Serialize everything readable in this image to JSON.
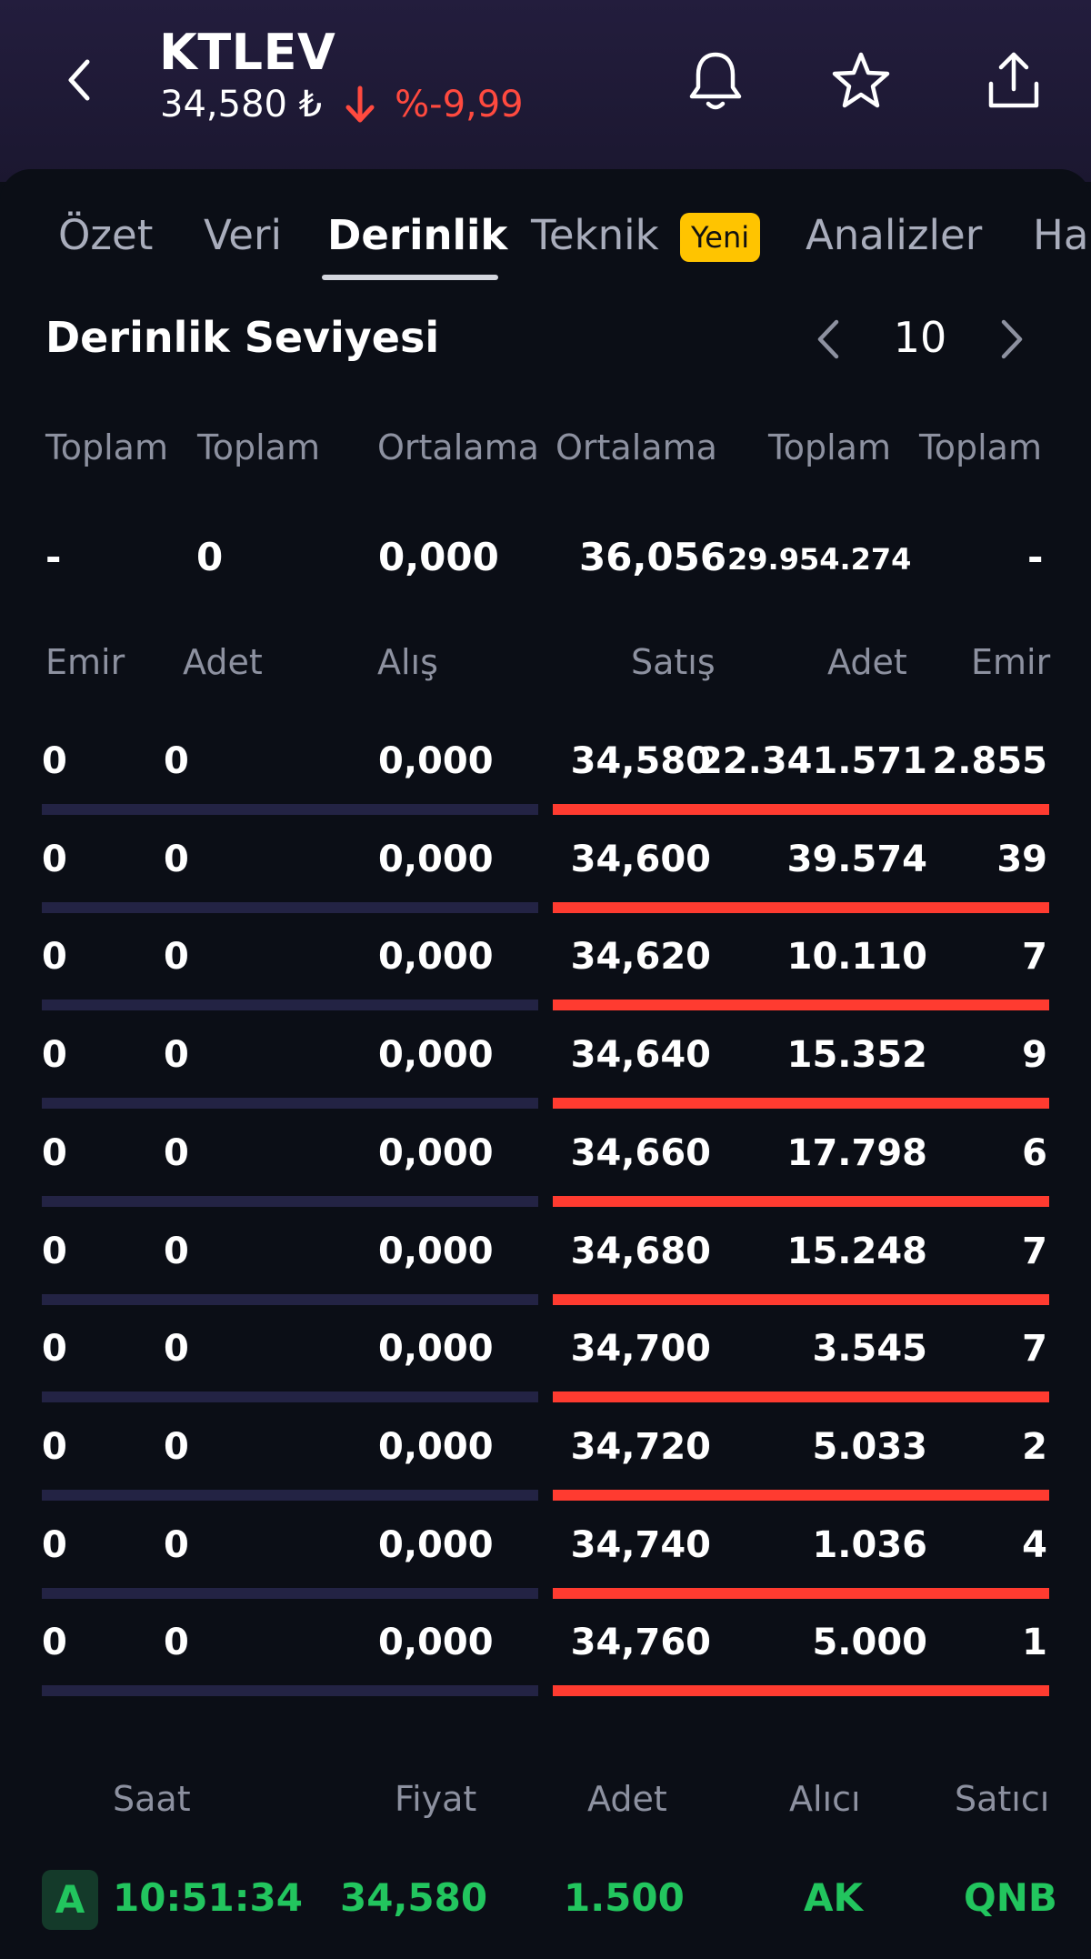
{
  "header": {
    "symbol": "KTLEV",
    "price": "34,580 ₺",
    "change": "%-9,99",
    "change_color": "#ff4a3f",
    "icons": [
      "chevron-left-icon",
      "bell-icon",
      "star-icon",
      "share-icon"
    ]
  },
  "tabs": [
    {
      "label": "Özet"
    },
    {
      "label": "Veri"
    },
    {
      "label": "Derinlik"
    },
    {
      "label": "Teknik"
    },
    {
      "label": "Analizler"
    },
    {
      "label": "Ha"
    }
  ],
  "tab_badge": "Yeni",
  "tab_badge_color": "#ffc400",
  "depth": {
    "title": "Derinlik Seviyesi",
    "level": "10",
    "summary_headers": [
      "Toplam",
      "Toplam",
      "Ortalama",
      "Ortalama",
      "Toplam",
      "Toplam"
    ],
    "summary_values": [
      "-",
      "0",
      "0,000",
      "36,056",
      "29.954.274",
      "-"
    ],
    "column_headers": [
      "Emir",
      "Adet",
      "Alış",
      "Satış",
      "Adet",
      "Emir"
    ],
    "rows": [
      {
        "buy_orders": "0",
        "buy_qty": "0",
        "bid": "0,000",
        "ask": "34,580",
        "sell_qty": "22.341.571",
        "sell_orders": "2.855"
      },
      {
        "buy_orders": "0",
        "buy_qty": "0",
        "bid": "0,000",
        "ask": "34,600",
        "sell_qty": "39.574",
        "sell_orders": "39"
      },
      {
        "buy_orders": "0",
        "buy_qty": "0",
        "bid": "0,000",
        "ask": "34,620",
        "sell_qty": "10.110",
        "sell_orders": "7"
      },
      {
        "buy_orders": "0",
        "buy_qty": "0",
        "bid": "0,000",
        "ask": "34,640",
        "sell_qty": "15.352",
        "sell_orders": "9"
      },
      {
        "buy_orders": "0",
        "buy_qty": "0",
        "bid": "0,000",
        "ask": "34,660",
        "sell_qty": "17.798",
        "sell_orders": "6"
      },
      {
        "buy_orders": "0",
        "buy_qty": "0",
        "bid": "0,000",
        "ask": "34,680",
        "sell_qty": "15.248",
        "sell_orders": "7"
      },
      {
        "buy_orders": "0",
        "buy_qty": "0",
        "bid": "0,000",
        "ask": "34,700",
        "sell_qty": "3.545",
        "sell_orders": "7"
      },
      {
        "buy_orders": "0",
        "buy_qty": "0",
        "bid": "0,000",
        "ask": "34,720",
        "sell_qty": "5.033",
        "sell_orders": "2"
      },
      {
        "buy_orders": "0",
        "buy_qty": "0",
        "bid": "0,000",
        "ask": "34,740",
        "sell_qty": "1.036",
        "sell_orders": "4"
      },
      {
        "buy_orders": "0",
        "buy_qty": "0",
        "bid": "0,000",
        "ask": "34,760",
        "sell_qty": "5.000",
        "sell_orders": "1"
      }
    ],
    "sell_bar_color": "#ff3b30",
    "buy_bar_color": "#232344"
  },
  "trades": {
    "headers": [
      "Saat",
      "Fiyat",
      "Adet",
      "Alıcı",
      "Satıcı"
    ],
    "rows": [
      {
        "side": "A",
        "time": "10:51:34",
        "price": "34,580",
        "qty": "1.500",
        "buyer": "AK",
        "seller": "QNB"
      }
    ],
    "color": "#22c55e"
  }
}
